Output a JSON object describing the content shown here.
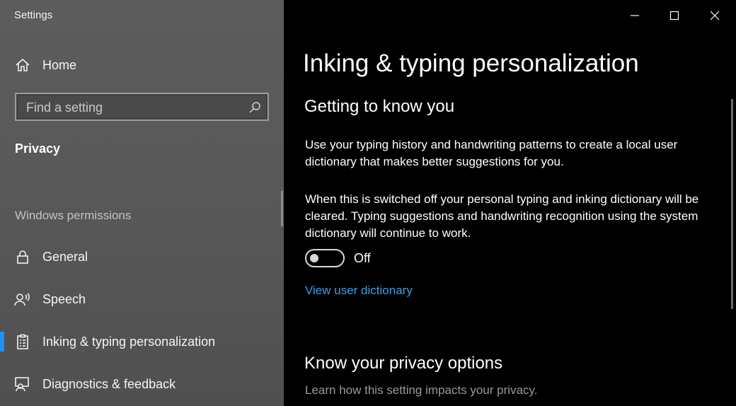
{
  "app": {
    "title": "Settings"
  },
  "sidebar": {
    "home_label": "Home",
    "search_placeholder": "Find a setting",
    "section_title": "Privacy",
    "group_title": "Windows permissions",
    "items": [
      {
        "label": "General",
        "icon": "lock-icon"
      },
      {
        "label": "Speech",
        "icon": "speech-icon"
      },
      {
        "label": "Inking & typing personalization",
        "icon": "clipboard-icon",
        "active": true
      },
      {
        "label": "Diagnostics & feedback",
        "icon": "diagnostics-icon"
      }
    ]
  },
  "main": {
    "title": "Inking & typing personalization",
    "section1": {
      "heading": "Getting to know you",
      "para1": "Use your typing history and handwriting patterns to create a local user dictionary that makes better suggestions for you.",
      "para2": "When this is switched off your personal typing and inking dictionary will be cleared. Typing suggestions and handwriting recognition using the system dictionary will continue to work.",
      "toggle_state": "Off",
      "link": "View user dictionary"
    },
    "section2": {
      "heading": "Know your privacy options",
      "subtext": "Learn how this setting impacts your privacy."
    }
  },
  "colors": {
    "accent": "#1e90ff",
    "link": "#3a9ee6",
    "sidebar_bg": "#5a5a5a",
    "main_bg": "#000000"
  }
}
